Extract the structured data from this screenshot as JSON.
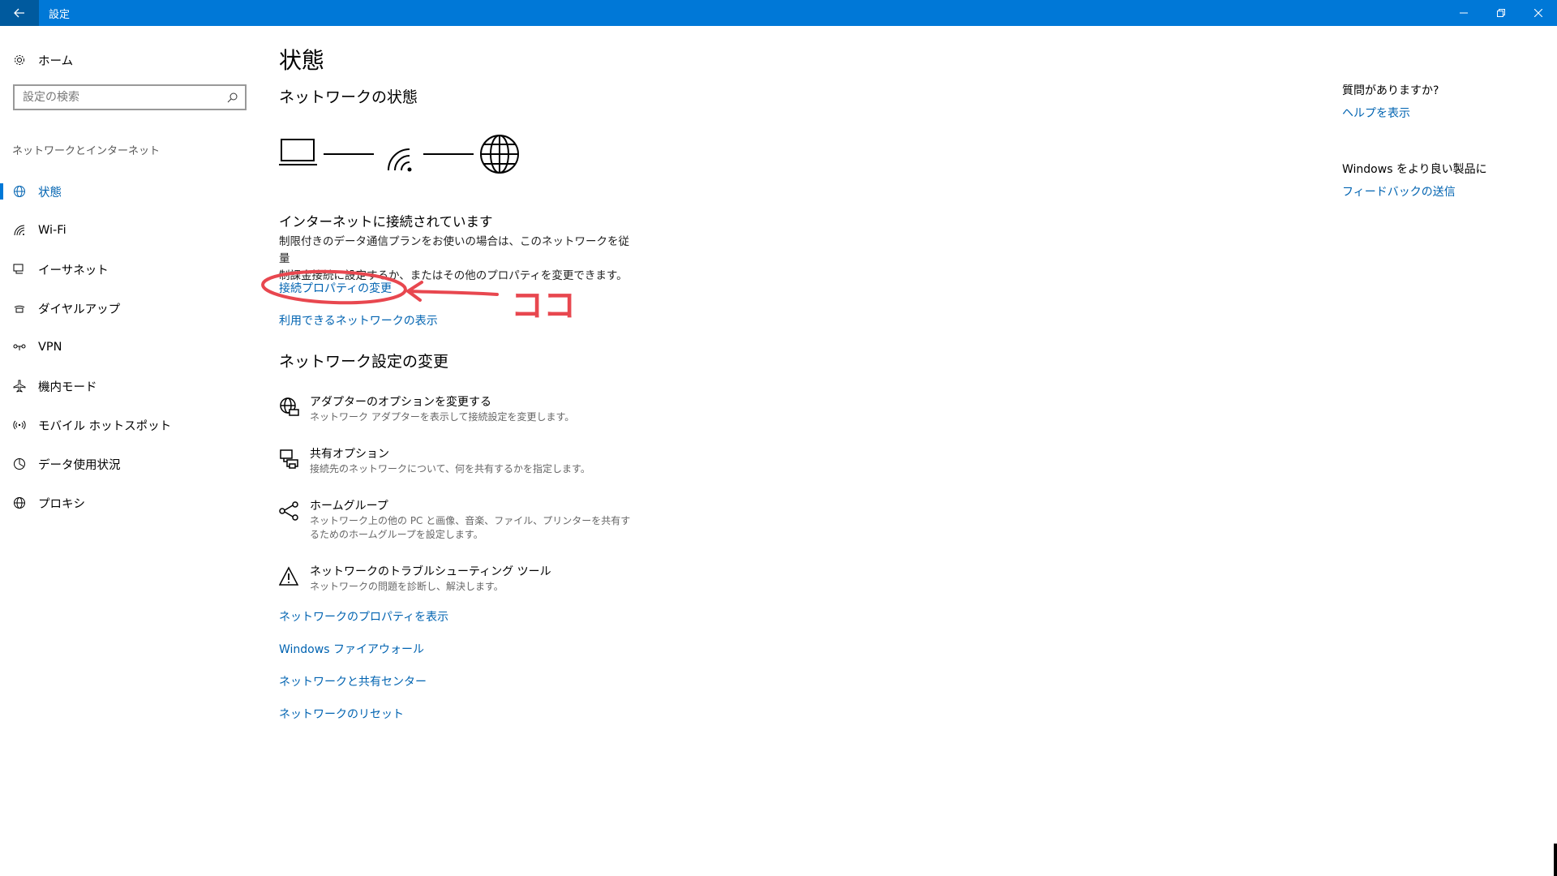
{
  "window": {
    "title": "設定"
  },
  "sidebar": {
    "home_label": "ホーム",
    "search_placeholder": "設定の検索",
    "section_label": "ネットワークとインターネット",
    "items": [
      {
        "label": "状態",
        "icon": "globe-status-icon",
        "active": true
      },
      {
        "label": "Wi-Fi",
        "icon": "wifi-icon"
      },
      {
        "label": "イーサネット",
        "icon": "ethernet-icon"
      },
      {
        "label": "ダイヤルアップ",
        "icon": "dialup-icon"
      },
      {
        "label": "VPN",
        "icon": "vpn-icon"
      },
      {
        "label": "機内モード",
        "icon": "airplane-icon"
      },
      {
        "label": "モバイル ホットスポット",
        "icon": "hotspot-icon"
      },
      {
        "label": "データ使用状況",
        "icon": "data-usage-icon"
      },
      {
        "label": "プロキシ",
        "icon": "proxy-globe-icon"
      }
    ]
  },
  "main": {
    "title": "状態",
    "network_status_title": "ネットワークの状態",
    "connected_title": "インターネットに接続されています",
    "connected_desc_line1": "制限付きのデータ通信プランをお使いの場合は、このネットワークを従量",
    "connected_desc_line2": "制課金接続に設定するか、またはその他のプロパティを変更できます。",
    "link_change_props": "接続プロパティの変更",
    "link_show_available": "利用できるネットワークの表示",
    "change_settings_title": "ネットワーク設定の変更",
    "settings": [
      {
        "title": "アダプターのオプションを変更する",
        "desc": "ネットワーク アダプターを表示して接続設定を変更します。"
      },
      {
        "title": "共有オプション",
        "desc": "接続先のネットワークについて、何を共有するかを指定します。"
      },
      {
        "title": "ホームグループ",
        "desc": "ネットワーク上の他の PC と画像、音楽、ファイル、プリンターを共有するためのホームグループを設定します。"
      },
      {
        "title": "ネットワークのトラブルシューティング ツール",
        "desc": "ネットワークの問題を診断し、解決します。"
      }
    ],
    "bottom_links": [
      "ネットワークのプロパティを表示",
      "Windows ファイアウォール",
      "ネットワークと共有センター",
      "ネットワークのリセット"
    ]
  },
  "annotation": {
    "text": "ココ",
    "color": "#e8474f"
  },
  "right_panel": {
    "question": "質問がありますか?",
    "help_link": "ヘルプを表示",
    "improve": "Windows をより良い製品に",
    "feedback_link": "フィードバックの送信"
  },
  "colors": {
    "titlebar": "#0078d7",
    "link": "#0063b1",
    "accent": "#0078d7"
  }
}
